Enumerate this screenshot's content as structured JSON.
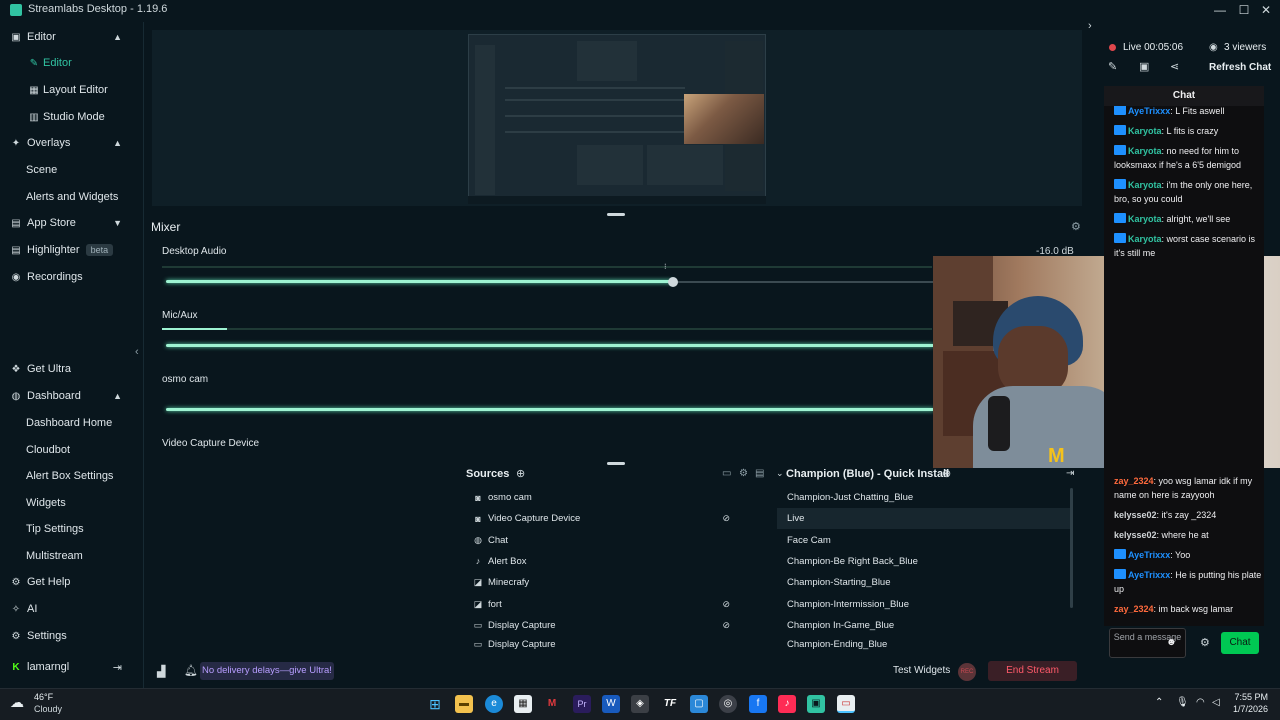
{
  "window": {
    "title": "Streamlabs Desktop - 1.19.6",
    "minimize": "—",
    "maximize": "☐",
    "close": "✕"
  },
  "sidebar": {
    "items": [
      {
        "label": "Editor"
      },
      {
        "label": "Editor"
      },
      {
        "label": "Layout Editor"
      },
      {
        "label": "Studio Mode"
      },
      {
        "label": "Overlays"
      },
      {
        "label": "Scene"
      },
      {
        "label": "Alerts and Widgets"
      },
      {
        "label": "App Store"
      },
      {
        "label": "Highlighter",
        "badge": "beta"
      },
      {
        "label": "Recordings"
      },
      {
        "label": "Get Ultra"
      },
      {
        "label": "Dashboard"
      },
      {
        "label": "Dashboard Home"
      },
      {
        "label": "Cloudbot"
      },
      {
        "label": "Alert Box Settings"
      },
      {
        "label": "Widgets"
      },
      {
        "label": "Tip Settings"
      },
      {
        "label": "Multistream"
      },
      {
        "label": "Get Help"
      },
      {
        "label": "AI"
      },
      {
        "label": "Settings"
      },
      {
        "label": "lamarngl"
      }
    ]
  },
  "mixer": {
    "title": "Mixer",
    "desktop_audio": {
      "label": "Desktop Audio",
      "db": "-16.0 dB",
      "volume_fraction": 0.66
    },
    "mic_aux": {
      "label": "Mic/Aux"
    },
    "osmo_cam": {
      "label": "osmo cam"
    },
    "video_capture": {
      "label": "Video Capture Device"
    }
  },
  "stream_status": {
    "live": "Live 00:05:06",
    "viewers": "3 viewers",
    "refresh": "Refresh Chat"
  },
  "chat": {
    "header": "Chat",
    "messages_top": [
      {
        "user": "AyeTrixxx",
        "color": "#1e90ff",
        "text": ": L Fits aswell",
        "badge": true
      },
      {
        "user": "Karyota",
        "color": "#31c3a2",
        "text": ": L fits is crazy",
        "badge": true
      },
      {
        "user": "Karyota",
        "color": "#31c3a2",
        "text": ": no need for him to looksmaxx if he's a 6'5 demigod",
        "badge": true
      },
      {
        "user": "Karyota",
        "color": "#31c3a2",
        "text": ": i'm the only one here, bro, so you could",
        "badge": true
      },
      {
        "user": "Karyota",
        "color": "#31c3a2",
        "text": ": alright, we'll see",
        "badge": true
      },
      {
        "user": "Karyota",
        "color": "#31c3a2",
        "text": ": worst case scenario is it's still me",
        "badge": true
      }
    ],
    "messages_bottom": [
      {
        "user": "zay_2324",
        "color": "#ff6a3d",
        "text": ": yoo wsg lamar idk if my name on here is zayyooh",
        "badge": false
      },
      {
        "user": "kelysse02",
        "color": "#cfd3d6",
        "text": ": it's zay _2324",
        "badge": false
      },
      {
        "user": "kelysse02",
        "color": "#cfd3d6",
        "text": ": where he at",
        "badge": false
      },
      {
        "user": "AyeTrixxx",
        "color": "#1e90ff",
        "text": ": Yoo",
        "badge": true
      },
      {
        "user": "AyeTrixxx",
        "color": "#1e90ff",
        "text": ": He is putting his plate up",
        "badge": true
      },
      {
        "user": "zay_2324",
        "color": "#ff6a3d",
        "text": ": im back wsg lamar",
        "badge": false
      }
    ],
    "input_placeholder": "Send a message",
    "send_label": "Chat"
  },
  "sources": {
    "title": "Sources",
    "items": [
      {
        "label": "osmo cam",
        "icon": "webcam-icon",
        "hidden": false
      },
      {
        "label": "Video Capture Device",
        "icon": "webcam-icon",
        "hidden": true
      },
      {
        "label": "Chat",
        "icon": "globe-icon",
        "hidden": false
      },
      {
        "label": "Alert Box",
        "icon": "bell-icon",
        "hidden": false
      },
      {
        "label": "Minecrafy",
        "icon": "gamepad-icon",
        "hidden": false
      },
      {
        "label": "fort",
        "icon": "gamepad-icon",
        "hidden": true
      },
      {
        "label": "Display Capture",
        "icon": "monitor-icon",
        "hidden": true
      },
      {
        "label": "Display Capture",
        "icon": "monitor-icon",
        "hidden": false
      }
    ]
  },
  "scenes": {
    "title": "Champion (Blue) - Quick Install",
    "items": [
      {
        "label": "Champion-Just Chatting_Blue",
        "selected": false
      },
      {
        "label": "Live",
        "selected": true
      },
      {
        "label": "Face Cam",
        "selected": false
      },
      {
        "label": "Champion-Be Right Back_Blue",
        "selected": false
      },
      {
        "label": "Champion-Starting_Blue",
        "selected": false
      },
      {
        "label": "Champion-Intermission_Blue",
        "selected": false
      },
      {
        "label": "Champion In-Game_Blue",
        "selected": false
      },
      {
        "label": "Champion-Ending_Blue",
        "selected": false
      }
    ]
  },
  "footer": {
    "ultra_banner": "No delivery delays—give Ultra!",
    "test_widgets": "Test Widgets",
    "rec": "REC",
    "end_stream": "End Stream"
  },
  "taskbar": {
    "weather_temp": "46°F",
    "weather_cond": "Cloudy",
    "time": "7:55 PM",
    "date": "1/7/2026"
  },
  "colors": {
    "accent": "#31c3a2",
    "end_stream": "#ff5a6a",
    "ultra": "#b79dff",
    "chat_send": "#00c853"
  }
}
